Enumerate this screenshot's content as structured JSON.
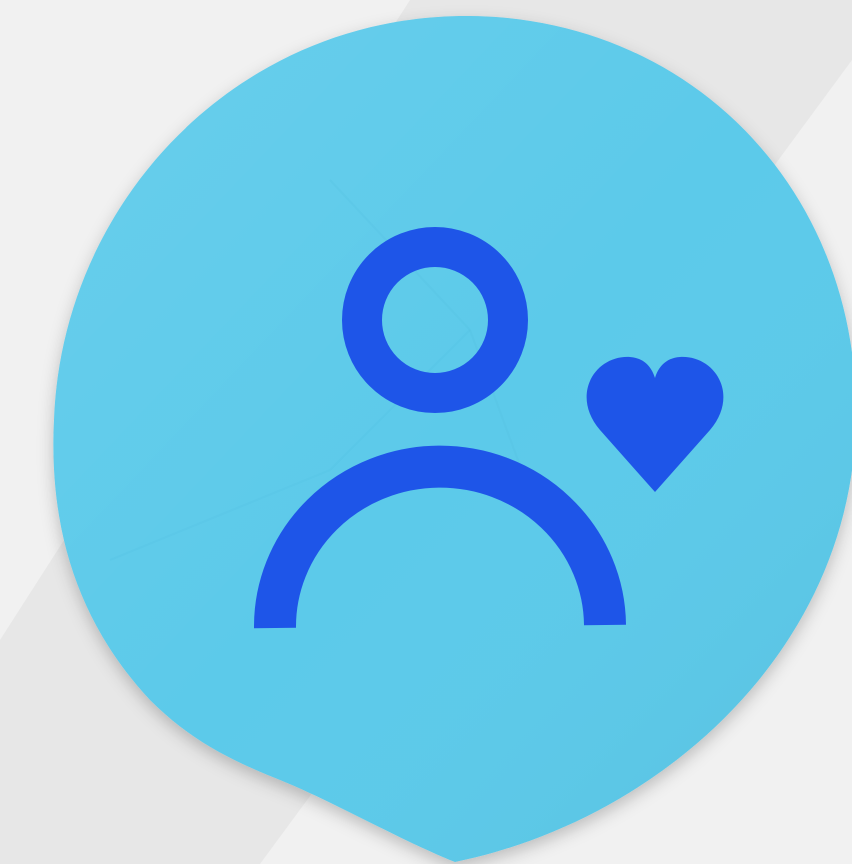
{
  "scene": {
    "background_color": "#f1f1f1",
    "background_stripe_color": "#e7e7e7",
    "sticker_color": "#5ccaea",
    "sticker_shade_color": "#52bfe0",
    "icon_color": "#1e55e8",
    "icon_name": "user-heart-icon",
    "sticker_name": "paper-sticker"
  }
}
